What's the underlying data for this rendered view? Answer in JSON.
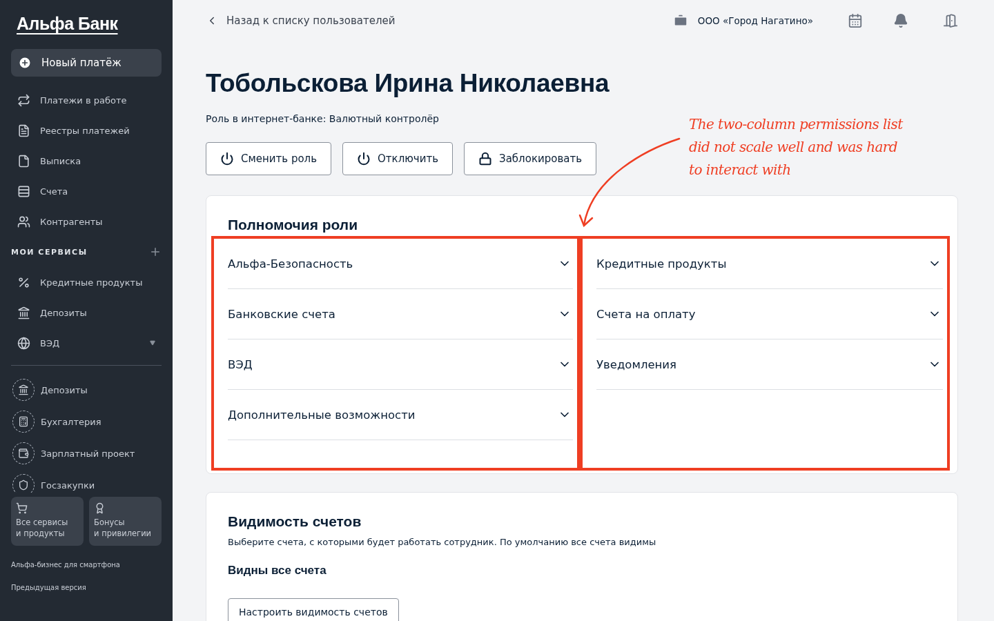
{
  "sidebar": {
    "logo": "Альфа Банк",
    "new_payment": "Новый платёж",
    "nav_items": [
      "Платежи в работе",
      "Реестры платежей",
      "Выписка",
      "Счета",
      "Контрагенты"
    ],
    "my_services": {
      "title": "МОИ СЕРВИСЫ",
      "items": [
        {
          "label": "Кредитные продукты",
          "expandable": false
        },
        {
          "label": "Депозиты",
          "expandable": false
        },
        {
          "label": "ВЭД",
          "expandable": true
        }
      ]
    },
    "suggested": [
      "Депозиты",
      "Бухгалтерия",
      "Зарплатный проект",
      "Госзакупки"
    ],
    "tiles": [
      {
        "line1": "Все сервисы",
        "line2": "и продукты"
      },
      {
        "line1": "Бонусы",
        "line2": "и привилегии"
      }
    ],
    "footer_links": [
      "Альфа-бизнес для смартфона",
      "Предыдущая версия"
    ]
  },
  "topbar": {
    "back": "Назад к списку пользователей",
    "company": "ООО «Город Нагатино»"
  },
  "user": {
    "name": "Тобольскова Ирина Николаевна",
    "role": "Роль в интернет-банке: Валютный контролёр"
  },
  "actions": [
    {
      "label": "Сменить роль",
      "kind": "power"
    },
    {
      "label": "Отключить",
      "kind": "power"
    },
    {
      "label": "Заблокировать",
      "kind": "lock"
    }
  ],
  "permissions": {
    "title": "Полномочия роли",
    "columns": [
      {
        "highlighted": true,
        "items": [
          {
            "label": "Альфа-Безопасность",
            "expanded": false
          },
          {
            "label": "Банковские счета",
            "expanded": false
          },
          {
            "label": "ВЭД",
            "expanded": false
          },
          {
            "label": "Дополнительные возможности",
            "expanded": false
          }
        ]
      },
      {
        "highlighted": true,
        "items": [
          {
            "label": "Кредитные продукты",
            "expanded": false
          },
          {
            "label": "Счета на оплату",
            "expanded": false
          },
          {
            "label": "Уведомления",
            "expanded": false
          }
        ]
      }
    ]
  },
  "visibility": {
    "title": "Видимость счетов",
    "description": "Выберите счета, с которыми будет работать сотрудник. По умолчанию все счета видимы",
    "status": "Видны все счета",
    "button": "Настроить видимость счетов"
  },
  "annotation": {
    "lines": [
      "The two-column permissions list",
      "did not scale well and was hard",
      "to interact with"
    ]
  }
}
